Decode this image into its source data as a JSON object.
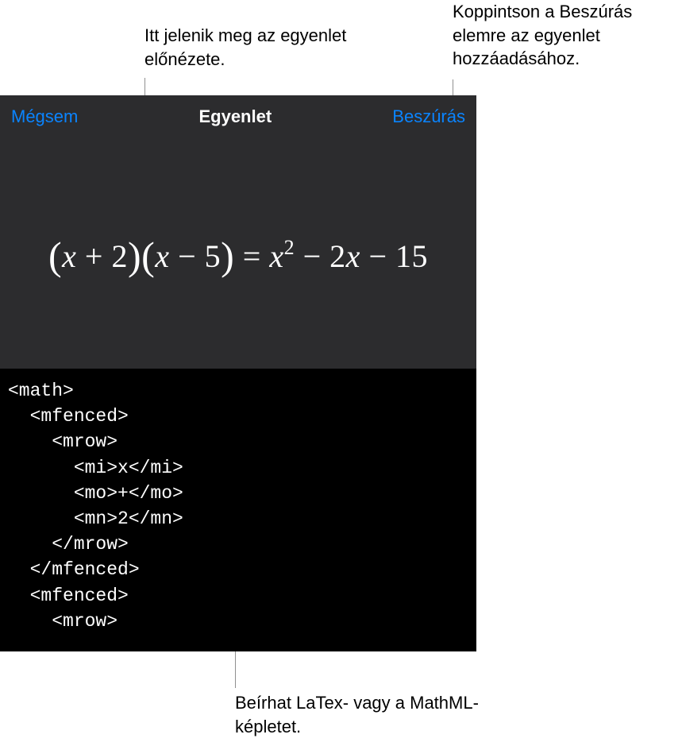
{
  "callouts": {
    "preview": "Itt jelenik meg az egyenlet előnézete.",
    "insert": "Koppintson a Beszúrás elemre az egyenlet hozzáadásához.",
    "input": "Beírhat LaTex- vagy a MathML-képletet."
  },
  "titlebar": {
    "cancel_label": "Mégsem",
    "title": "Egyenlet",
    "insert_label": "Beszúrás"
  },
  "equation_preview": {
    "lhs_term1_var": "x",
    "lhs_term1_op": "+",
    "lhs_term1_num": "2",
    "lhs_term2_var": "x",
    "lhs_term2_op": "−",
    "lhs_term2_num": "5",
    "eq": "=",
    "rhs_a_var": "x",
    "rhs_a_exp": "2",
    "rhs_op1": "−",
    "rhs_b_coef": "2",
    "rhs_b_var": "x",
    "rhs_op2": "−",
    "rhs_c": "15"
  },
  "code_input": "<math>\n  <mfenced>\n    <mrow>\n      <mi>x</mi>\n      <mo>+</mo>\n      <mn>2</mn>\n    </mrow>\n  </mfenced>\n  <mfenced>\n    <mrow>",
  "colors": {
    "accent": "#0a84ff",
    "panel_bg": "#2c2c2e",
    "code_bg": "#000000",
    "text_light": "#ffffff"
  }
}
